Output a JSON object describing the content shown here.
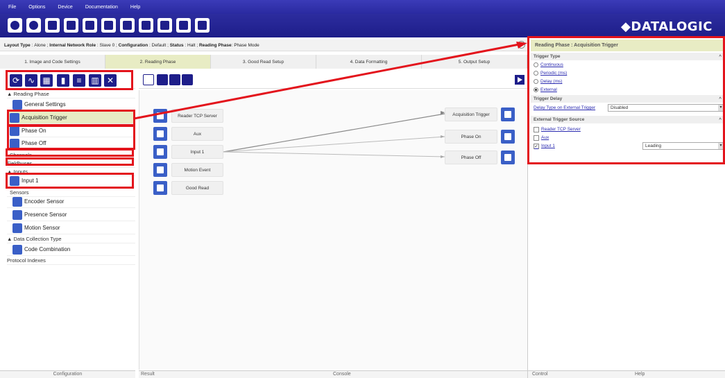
{
  "menu": [
    "File",
    "Options",
    "Device",
    "Documentation",
    "Help"
  ],
  "toolbar": {
    "logo": "◆DATALOGIC",
    "button_count": 11
  },
  "infobar": {
    "layout_type_label": "Layout Type",
    "layout_type": "Alone",
    "network_role_label": "Internal Network Role",
    "network_role": "Slave 0",
    "configuration_label": "Configuration",
    "configuration": "Default",
    "status_label": "Status",
    "status": "Halt",
    "reading_phase_label": "Reading Phase",
    "reading_phase": "Phase Mode"
  },
  "steps": [
    "1. Image and Code Settings",
    "2. Reading Phase",
    "3. Good Read Setup",
    "4. Data Formatting",
    "5. Output Setup"
  ],
  "active_step": 1,
  "tree": {
    "reading_phase": "▲ Reading Phase",
    "general_settings": "General Settings",
    "acquisition_trigger": "Acquisition Trigger",
    "phase_on": "Phase On",
    "phase_off": "Phase Off",
    "channels": "Channels",
    "fieldbuses": "Fieldbuses",
    "inputs": "▲ Inputs",
    "input1": "Input 1",
    "sensors": "Sensors",
    "encoder": "Encoder Sensor",
    "presence": "Presence Sensor",
    "motion": "Motion Sensor",
    "data_collection": "▲ Data Collection Type",
    "code_combination": "Code Combination",
    "protocol_indexes": "Protocol Indexes"
  },
  "left_footer": "Configuration",
  "canvas": {
    "sources": [
      "Reader TCP Server",
      "Aux",
      "Input 1",
      "Motion Event",
      "Good Read"
    ],
    "targets": [
      "Acquisition Trigger",
      "Phase On",
      "Phase Off"
    ]
  },
  "canvas_footer": {
    "result": "Result",
    "console": "Console"
  },
  "right_panel": {
    "title": "Reading Phase : Acquisition Trigger",
    "trigger_type_title": "Trigger Type",
    "trigger_types": [
      "Continuous",
      "Periodic (ms)",
      "Delay (ms)",
      "External"
    ],
    "selected_trigger": "External",
    "trigger_delay_title": "Trigger Delay",
    "delay_type_label": "Delay Type on External Trigger",
    "delay_type_value": "Disabled",
    "ext_source_title": "External Trigger Source",
    "sources": [
      "Reader TCP Server",
      "Aux",
      "Input 1"
    ],
    "input1_edge": "Leading",
    "footer_control": "Control",
    "footer_help": "Help"
  },
  "colors": {
    "accent": "#1e1e8a",
    "highlight": "#e8ecc4",
    "annotation": "#e3141c"
  }
}
